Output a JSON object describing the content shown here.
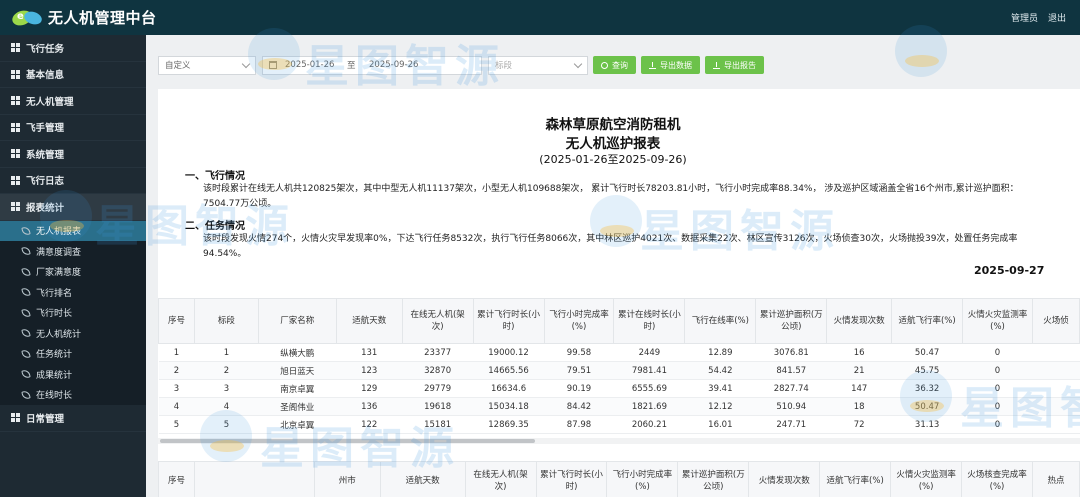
{
  "app": {
    "title": "无人机管理中台",
    "logo_text": "e",
    "user_label": "管理员",
    "logout_label": "退出"
  },
  "sidebar": {
    "items": [
      {
        "label": "飞行任务"
      },
      {
        "label": "基本信息"
      },
      {
        "label": "无人机管理"
      },
      {
        "label": "飞手管理"
      },
      {
        "label": "系统管理"
      },
      {
        "label": "飞行日志"
      },
      {
        "label": "报表统计"
      }
    ],
    "sub_items": [
      {
        "label": "无人机报表"
      },
      {
        "label": "满意度调查"
      },
      {
        "label": "厂家满意度"
      },
      {
        "label": "飞行排名"
      },
      {
        "label": "飞行时长"
      },
      {
        "label": "无人机统计"
      },
      {
        "label": "任务统计"
      },
      {
        "label": "成果统计"
      },
      {
        "label": "在线时长"
      }
    ],
    "last_item": {
      "label": "日常管理"
    }
  },
  "filters": {
    "mode_value": "自定义",
    "date_start": "2025-01-26",
    "date_sep": "至",
    "date_end": "2025-09-26",
    "section_placeholder": "标段",
    "query_label": "查询",
    "export_data_label": "导出数据",
    "export_report_label": "导出报告"
  },
  "report": {
    "title_line1": "森林草原航空消防租机",
    "title_line2": "无人机巡护报表",
    "period": "(2025-01-26至2025-09-26)",
    "section1_heading": "一、飞行情况",
    "section1_text": "该时段累计在线无人机共120825架次，其中中型无人机11137架次，小型无人机109688架次，  累计飞行时长78203.81小时，飞行小时完成率88.34%，  涉及巡护区域涵盖全省16个州市,累计巡护面积：7504.77万公顷。",
    "section2_heading": "二、任务情况",
    "section2_text": "该时段发现火情274个，火情火灾早发现率0%，下达飞行任务8532次，执行飞行任务8066次，其中林区巡护4021次、数据采集22次、林区宣传3126次，火场侦查30次，火场抛投39次，处置任务完成率94.54%。",
    "report_date": "2025-09-27"
  },
  "table1": {
    "headers": [
      "序号",
      "标段",
      "厂家名称",
      "适航天数",
      "在线无人机(架次)",
      "累计飞行时长(小时)",
      "飞行小时完成率(%)",
      "累计在线时长(小时)",
      "飞行在线率(%)",
      "累计巡护面积(万公顷)",
      "火情发现次数",
      "适航飞行率(%)",
      "火情火灾监测率(%)",
      "火场侦"
    ],
    "rows": [
      [
        "1",
        "1",
        "纵横大鹏",
        "131",
        "23377",
        "19000.12",
        "99.58",
        "2449",
        "12.89",
        "3076.81",
        "16",
        "50.47",
        "0",
        ""
      ],
      [
        "2",
        "2",
        "旭日蓝天",
        "123",
        "32870",
        "14665.56",
        "79.51",
        "7981.41",
        "54.42",
        "841.57",
        "21",
        "45.75",
        "0",
        ""
      ],
      [
        "3",
        "3",
        "南京卓翼",
        "129",
        "29779",
        "16634.6",
        "90.19",
        "6555.69",
        "39.41",
        "2827.74",
        "147",
        "36.32",
        "0",
        ""
      ],
      [
        "4",
        "4",
        "圣阁伟业",
        "136",
        "19618",
        "15034.18",
        "84.42",
        "1821.69",
        "12.12",
        "510.94",
        "18",
        "50.47",
        "0",
        ""
      ],
      [
        "5",
        "5",
        "北京卓翼",
        "122",
        "15181",
        "12869.35",
        "87.98",
        "2060.21",
        "16.01",
        "247.71",
        "72",
        "31.13",
        "0",
        ""
      ]
    ]
  },
  "table2": {
    "headers": [
      "序号",
      "",
      "州市",
      "适航天数",
      "在线无人机(架次)",
      "累计飞行时长(小时)",
      "飞行小时完成率(%)",
      "累计巡护面积(万公顷)",
      "火情发现次数",
      "适航飞行率(%)",
      "火情火灾监测率(%)",
      "火场核查完成率(%)",
      "热点"
    ]
  },
  "watermark": {
    "text": "星图智源"
  },
  "colors": {
    "header_bg": "#0f3440",
    "sidebar_bg": "#1e2a33",
    "accent_green": "#6cc24a",
    "active_sub": "#2a6f8b"
  }
}
